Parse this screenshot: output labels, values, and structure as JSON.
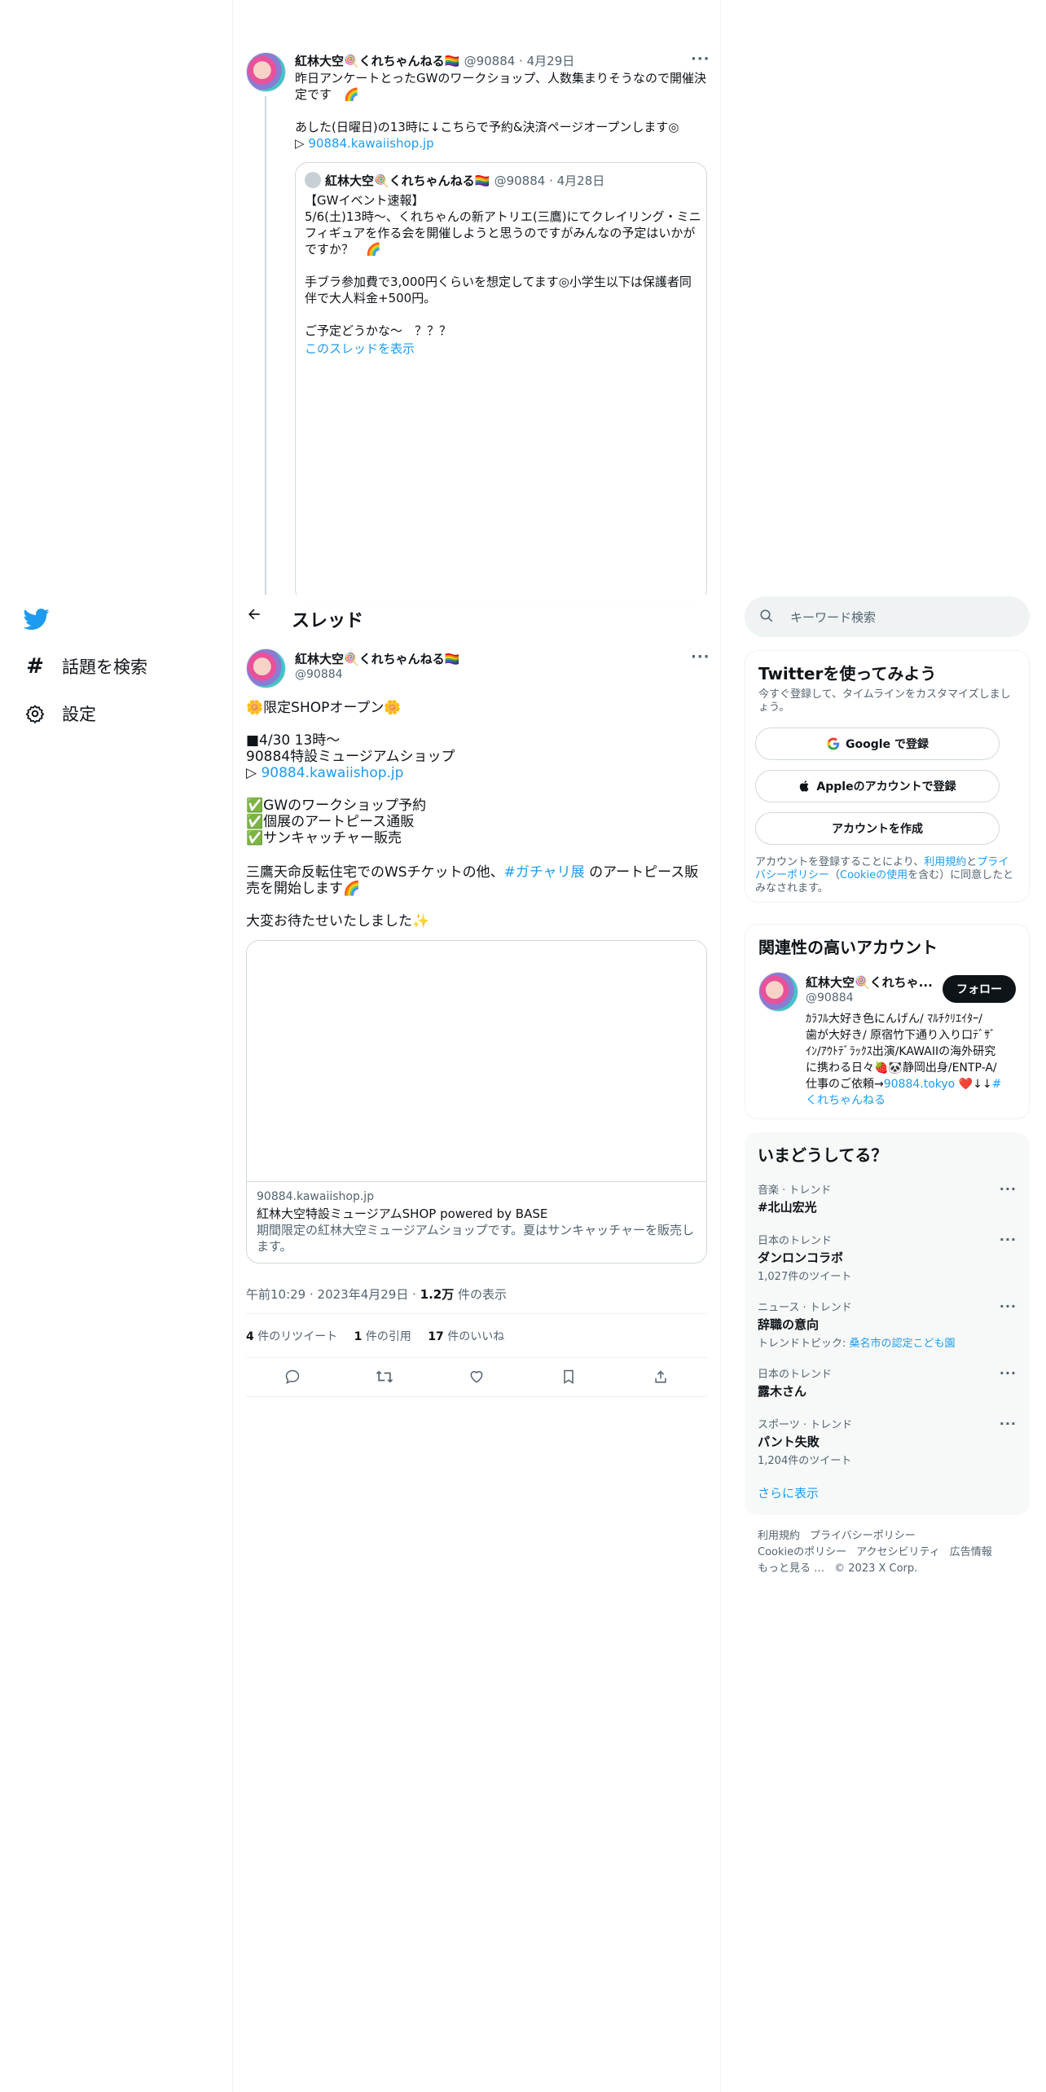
{
  "nav": {
    "explore": "話題を検索",
    "settings": "設定"
  },
  "header": {
    "title": "スレッド"
  },
  "parent_tweet": {
    "name": "紅林大空🍭くれちゃんねる🏳️‍🌈",
    "handle_date": "@90884 · 4月29日",
    "text1": "昨日アンケートとったGWのワークショップ、人数集まりそうなので開催決",
    "text2": "定です　🌈",
    "text3": "あした(日曜日)の13時に↓こちらで予約&決済ページオープンします◎",
    "text4_prefix": "▷ ",
    "link": "90884.kawaiishop.jp",
    "quote": {
      "name": "紅林大空🍭くれちゃんねる🏳️‍🌈",
      "handle_date": "@90884 · 4月28日",
      "l1": "【GWイベント速報】",
      "l2": "5/6(土)13時〜、くれちゃんの新アトリエ(三鷹)にてクレイリング・ミニ",
      "l3": "フィギュアを作る会を開催しようと思うのですがみんなの予定はいかが",
      "l4": "ですか？　🌈",
      "l5": "手ブラ参加費で3,000円くらいを想定してます◎小学生以下は保護者同",
      "l6": "伴で大人料金+500円。",
      "l7": "ご予定どうかな〜　？？？",
      "show_thread": "このスレッドを表示"
    }
  },
  "main_tweet": {
    "name": "紅林大空🍭くれちゃんねる🏳️‍🌈",
    "handle": "@90884",
    "lines": {
      "l1": "🌼限定SHOPオープン🌼",
      "l2": "■4/30 13時〜",
      "l3": "90884特設ミュージアムショップ",
      "l4_prefix": "▷ ",
      "l4_link": "90884.kawaiishop.jp",
      "l5": "✅GWのワークショップ予約",
      "l6": "✅個展のアートピース通販",
      "l7": "✅サンキャッチャー販売",
      "l8_a": "三鷹天命反転住宅でのWSチケットの他、",
      "l8_tag": "#ガチャリ展",
      "l8_b": " のアートピース販",
      "l9": "売を開始します🌈",
      "l10": "大変お待たせいたしました✨"
    },
    "card": {
      "domain": "90884.kawaiishop.jp",
      "title": "紅林大空特設ミュージアムSHOP powered by BASE",
      "desc1": "期間限定の紅林大空ミュージアムショップです。夏はサンキャッチャーを販売し",
      "desc2": "ます。"
    },
    "timestamp": "午前10:29 · 2023年4月29日 · ",
    "views_num": "1.2万",
    "views_label": " 件の表示",
    "retweets_num": "4",
    "retweets_label": " 件のリツイート",
    "quotes_num": "1",
    "quotes_label": " 件の引用",
    "likes_num": "17",
    "likes_label": " 件のいいね"
  },
  "search": {
    "placeholder": "キーワード検索"
  },
  "signup": {
    "title": "Twitterを使ってみよう",
    "sub1": "今すぐ登録して、タイムラインをカスタマイズしまし",
    "sub2": "ょう。",
    "google": "Google で登録",
    "apple": "Appleのアカウントで登録",
    "create": "アカウントを作成",
    "terms1a": "アカウントを登録することにより、",
    "terms1b": "利用規約",
    "terms1c": "と",
    "terms1d": "プライ",
    "terms2a": "バシーポリシー",
    "terms2b": "（",
    "terms2c": "Cookieの使用",
    "terms2d": "を含む）に同意したと",
    "terms3": "みなされます。"
  },
  "related": {
    "title": "関連性の高いアカウント",
    "name": "紅林大空🍭くれちゃ...",
    "handle": "@90884",
    "follow": "フォロー",
    "bio1": "ｶﾗﾌﾙ大好き色にんげん/ ﾏﾙﾁｸﾘｴｲﾀｰ/",
    "bio2": "歯が大好き/ 原宿竹下通り入り口ﾃﾞｻﾞ",
    "bio3": "ｲﾝ/ｱｳﾄﾃﾞﾗｯｸｽ出演/KAWAIIの海外研究",
    "bio4": "に携わる日々🍓🐼静岡出身/ENTP-A/",
    "bio5a": "仕事のご依頼→",
    "bio5b": "90884.tokyo",
    "bio5c": " ❤️↓↓",
    "bio5d": "#",
    "bio6": "くれちゃんねる"
  },
  "trends": {
    "title": "いまどうしてる？",
    "items": [
      {
        "cat": "音楽 · トレンド",
        "name": "#北山宏光",
        "sub": ""
      },
      {
        "cat": "日本のトレンド",
        "name": "ダンロンコラボ",
        "sub": "1,027件のツイート"
      },
      {
        "cat": "ニュース · トレンド",
        "name": "辞職の意向",
        "sub_a": "トレンドトピック: ",
        "sub_b": "桑名市の認定こども園"
      },
      {
        "cat": "日本のトレンド",
        "name": "露木さん",
        "sub": ""
      },
      {
        "cat": "スポーツ · トレンド",
        "name": "パント失敗",
        "sub": "1,204件のツイート"
      }
    ],
    "more": "さらに表示"
  },
  "footer": {
    "terms": "利用規約",
    "privacy": "プライバシーポリシー",
    "cookie": "Cookieのポリシー",
    "access": "アクセシビリティ",
    "ads": "広告情報",
    "more": "もっと見る …",
    "copy": "© 2023 X Corp."
  },
  "colors": {
    "link": "#1d9bf0",
    "text": "#0f1419",
    "muted": "#536471",
    "border": "#cfd9de"
  }
}
